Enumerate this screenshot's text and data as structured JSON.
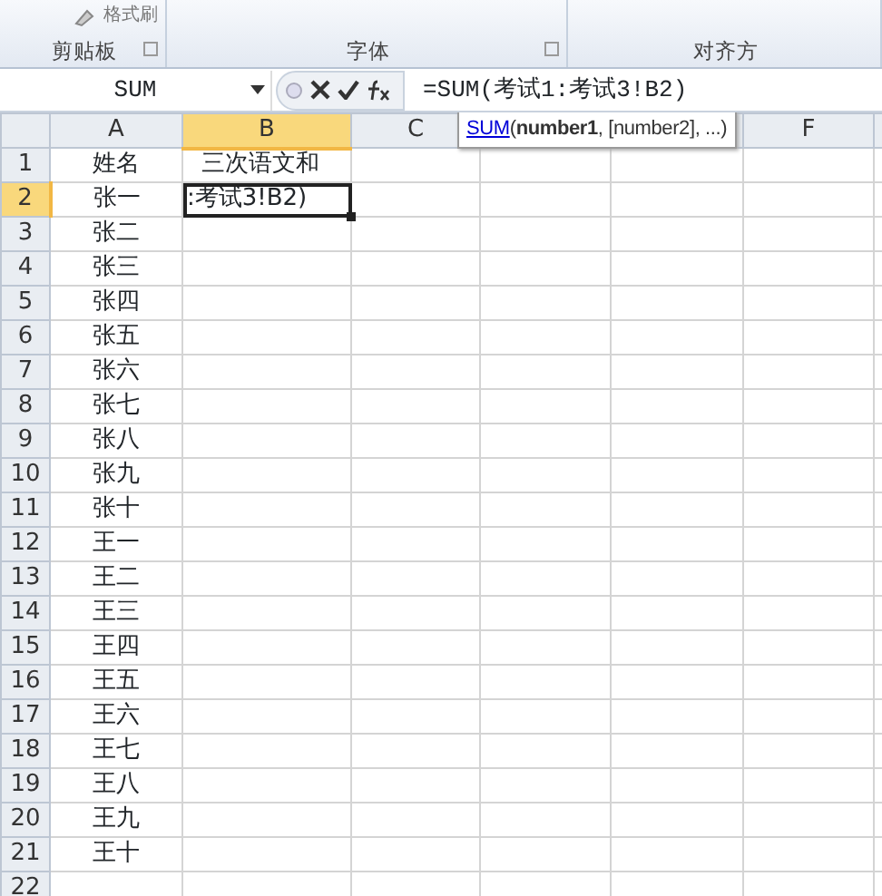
{
  "ribbon": {
    "top_button": "格式刷",
    "groups": [
      {
        "label": "剪贴板",
        "launcher": true
      },
      {
        "label": "字体",
        "launcher": true
      },
      {
        "label": "对齐方",
        "launcher": false
      }
    ]
  },
  "formula_bar": {
    "name_box": "SUM",
    "formula": "=SUM(考试1:考试3!B2)"
  },
  "tooltip": {
    "function": "SUM",
    "arguments": "(**number1**, [number2], ...)"
  },
  "columns": [
    {
      "label": "A",
      "selected": false
    },
    {
      "label": "B",
      "selected": true
    },
    {
      "label": "C",
      "selected": false
    },
    {
      "label": "F",
      "selected": false
    }
  ],
  "rows": [
    {
      "number": "1",
      "selected": false,
      "cells": [
        "姓名",
        "三次语文和"
      ]
    },
    {
      "number": "2",
      "selected": true,
      "cells": [
        "张一",
        ":考试3!B2)"
      ],
      "editing": true
    },
    {
      "number": "3",
      "selected": false,
      "cells": [
        "张二",
        ""
      ]
    },
    {
      "number": "4",
      "selected": false,
      "cells": [
        "张三",
        ""
      ]
    },
    {
      "number": "5",
      "selected": false,
      "cells": [
        "张四",
        ""
      ]
    },
    {
      "number": "6",
      "selected": false,
      "cells": [
        "张五",
        ""
      ]
    },
    {
      "number": "7",
      "selected": false,
      "cells": [
        "张六",
        ""
      ]
    },
    {
      "number": "8",
      "selected": false,
      "cells": [
        "张七",
        ""
      ]
    },
    {
      "number": "9",
      "selected": false,
      "cells": [
        "张八",
        ""
      ]
    },
    {
      "number": "10",
      "selected": false,
      "cells": [
        "张九",
        ""
      ]
    },
    {
      "number": "11",
      "selected": false,
      "cells": [
        "张十",
        ""
      ]
    },
    {
      "number": "12",
      "selected": false,
      "cells": [
        "王一",
        ""
      ]
    },
    {
      "number": "13",
      "selected": false,
      "cells": [
        "王二",
        ""
      ]
    },
    {
      "number": "14",
      "selected": false,
      "cells": [
        "王三",
        ""
      ]
    },
    {
      "number": "15",
      "selected": false,
      "cells": [
        "王四",
        ""
      ]
    },
    {
      "number": "16",
      "selected": false,
      "cells": [
        "王五",
        ""
      ]
    },
    {
      "number": "17",
      "selected": false,
      "cells": [
        "王六",
        ""
      ]
    },
    {
      "number": "18",
      "selected": false,
      "cells": [
        "王七",
        ""
      ]
    },
    {
      "number": "19",
      "selected": false,
      "cells": [
        "王八",
        ""
      ]
    },
    {
      "number": "20",
      "selected": false,
      "cells": [
        "王九",
        ""
      ]
    },
    {
      "number": "21",
      "selected": false,
      "cells": [
        "王十",
        ""
      ]
    },
    {
      "number": "22",
      "selected": false,
      "cells": [
        "",
        ""
      ]
    }
  ]
}
